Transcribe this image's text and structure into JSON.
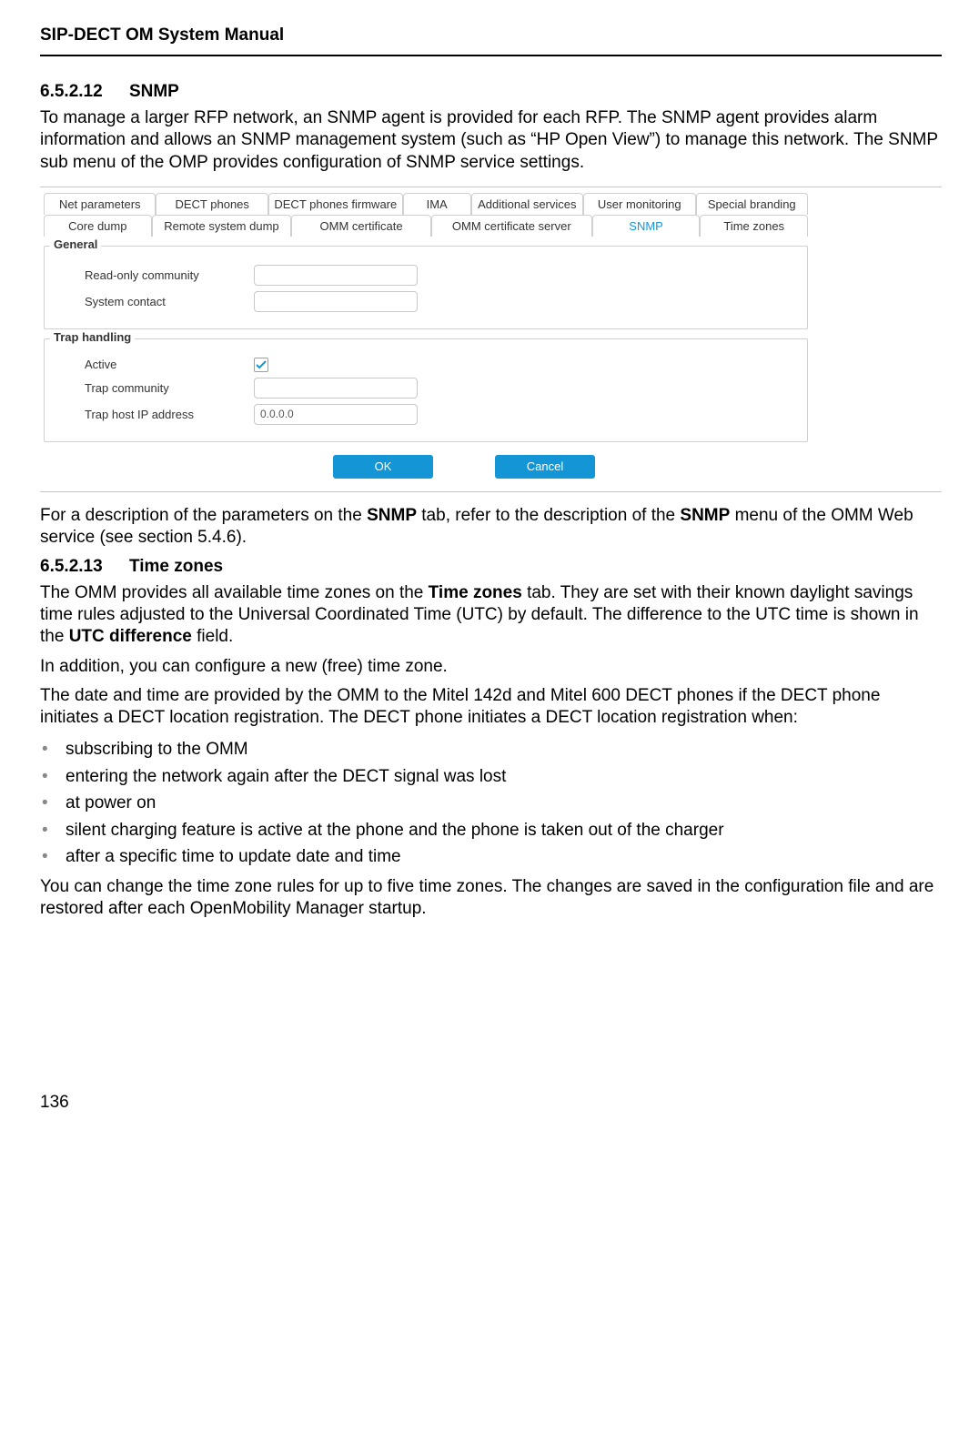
{
  "header": {
    "doc_title": "SIP-DECT OM System Manual"
  },
  "sec1": {
    "num": "6.5.2.12",
    "title": "SNMP",
    "para1": "To manage a larger RFP network, an SNMP agent is provided for each RFP. The SNMP agent provides alarm information and allows an SNMP management system (such as “HP Open View”) to manage this network. The SNMP sub menu of the OMP provides configuration of SNMP service settings.",
    "para2_a": "For a description of the parameters on the ",
    "para2_b": "SNMP",
    "para2_c": " tab, refer to the description of the ",
    "para2_d": "SNMP",
    "para2_e": " menu of the OMM Web service (see section 5.4.6)."
  },
  "ui": {
    "tabs1": [
      "Net parameters",
      "DECT phones",
      "DECT phones firmware",
      "IMA",
      "Additional services",
      "User monitoring",
      "Special branding"
    ],
    "tabs2": [
      "Core dump",
      "Remote system dump",
      "OMM certificate",
      "OMM certificate server",
      "SNMP",
      "Time zones"
    ],
    "general": {
      "legend": "General",
      "rows": [
        {
          "label": "Read-only community",
          "type": "text",
          "value": ""
        },
        {
          "label": "System contact",
          "type": "text",
          "value": ""
        }
      ]
    },
    "trap": {
      "legend": "Trap handling",
      "rows": [
        {
          "label": "Active",
          "type": "check",
          "checked": true
        },
        {
          "label": "Trap community",
          "type": "text",
          "value": ""
        },
        {
          "label": "Trap host IP address",
          "type": "text",
          "value": "0.0.0.0"
        }
      ]
    },
    "buttons": {
      "ok": "OK",
      "cancel": "Cancel"
    }
  },
  "sec2": {
    "num": "6.5.2.13",
    "title": "Time zones",
    "p1_a": "The OMM provides all available time zones on the ",
    "p1_b": "Time zones",
    "p1_c": " tab. They are set with their known daylight savings time rules adjusted to the Universal Coordinated Time (UTC) by default. The difference to the UTC time is shown in the ",
    "p1_d": "UTC difference",
    "p1_e": " field.",
    "p2": "In addition, you can configure a new (free) time zone.",
    "p3": "The date and time are provided by the OMM to the Mitel 142d and Mitel 600 DECT phones if the DECT phone initiates a DECT location registration. The DECT phone initiates a DECT location registration when:",
    "bullets": [
      "subscribing to the OMM",
      "entering the network again after the DECT signal was lost",
      "at power on",
      "silent charging feature is active at the phone and the phone is taken out of the charger",
      "after a specific time to update date and time"
    ],
    "p4": "You can change the time zone rules for up to five time zones. The changes are saved in the configuration file and are restored after each OpenMobility Manager startup."
  },
  "footer": {
    "page": "136"
  }
}
